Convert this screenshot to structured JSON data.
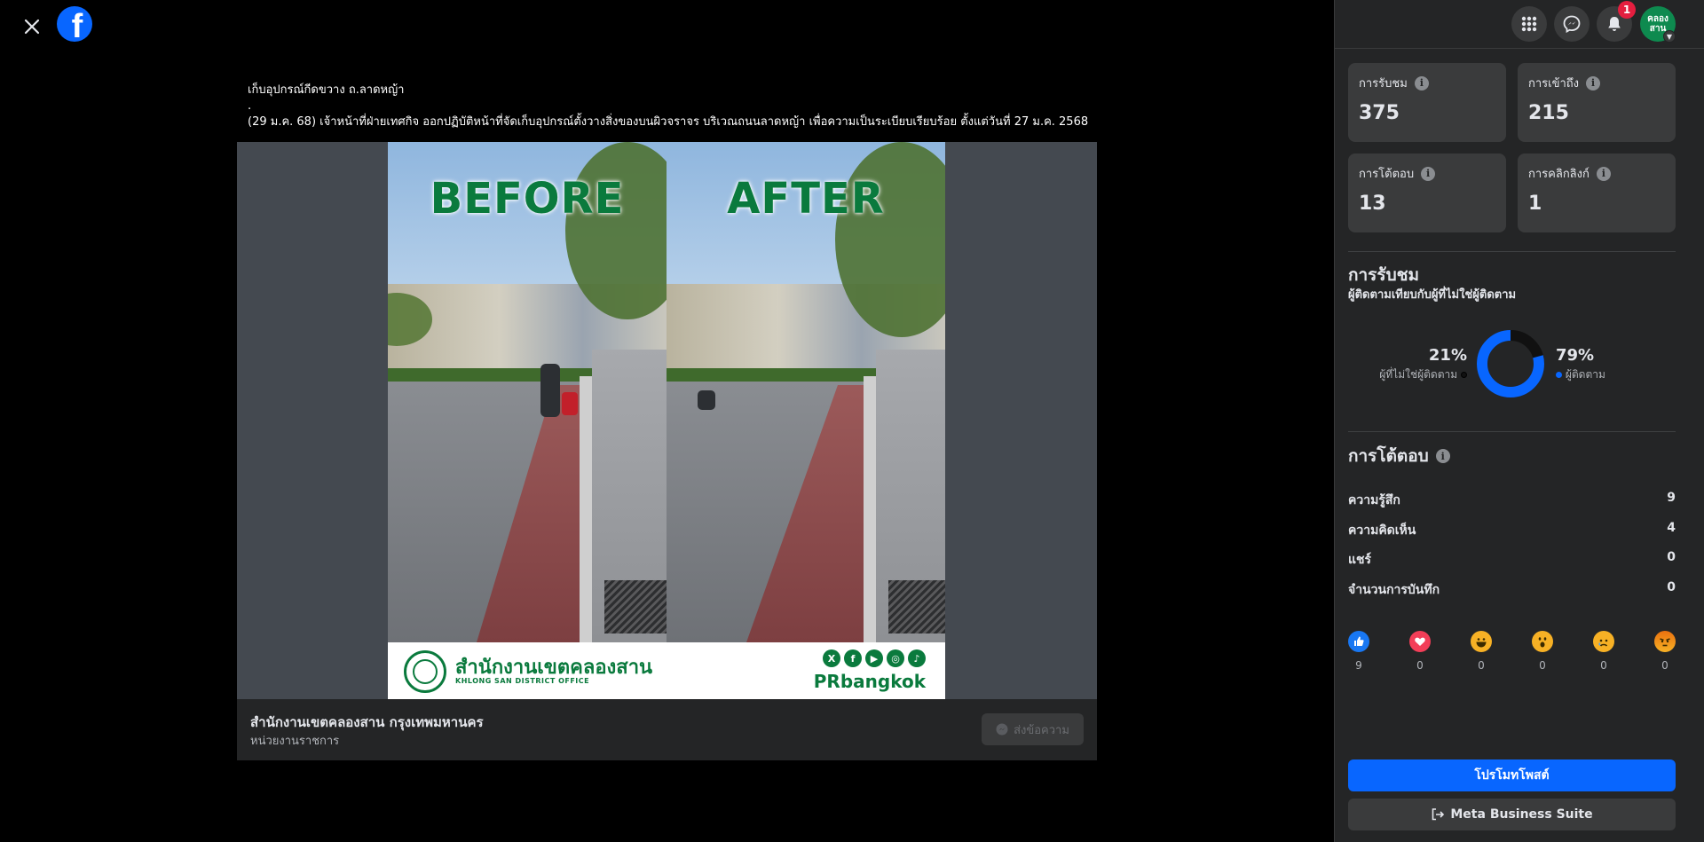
{
  "header": {
    "close_icon": "close-icon",
    "logo_letter": "f"
  },
  "caption": {
    "line1": "เก็บอุปกรณ์กีดขวาง ถ.ลาดหญ้า",
    "line2": ".",
    "line3": "(29 ม.ค. 68) เจ้าหน้าที่ฝ่ายเทศกิจ ออกปฏิบัติหน้าที่จัดเก็บอุปกรณ์ตั้งวางสิ่งของบนผิวจราจร บริเวณถนนลาดหญ้า เพื่อความเป็นระเบียบเรียบร้อย ตั้งแต่วันที่ 27 ม.ค. 2568"
  },
  "photo": {
    "before_label": "BEFORE",
    "after_label": "AFTER",
    "office_th": "สำนักงานเขตคลองสาน",
    "office_en": "KHLONG SAN DISTRICT OFFICE",
    "social": [
      "X",
      "f",
      "▶",
      "◎",
      "♪"
    ],
    "brand": "PRbangkok"
  },
  "page": {
    "name": "สำนักงานเขตคลองสาน กรุงเทพมหานคร",
    "category": "หน่วยงานราชการ",
    "message_label": "ส่งข้อความ"
  },
  "topbar": {
    "notifications_count": "1",
    "avatar_text_1": "คลอง",
    "avatar_text_2": "สาน"
  },
  "stats": [
    {
      "label": "การรับชม",
      "value": "375"
    },
    {
      "label": "การเข้าถึง",
      "value": "215"
    },
    {
      "label": "การโต้ตอบ",
      "value": "13"
    },
    {
      "label": "การคลิกลิงก์",
      "value": "1"
    }
  ],
  "views": {
    "title": "การรับชม",
    "subtitle": "ผู้ติดตามเทียบกับผู้ที่ไม่ใช่ผู้ติดตาม",
    "non_followers_pct": "21%",
    "non_followers_label": "ผู้ที่ไม่ใช่ผู้ติดตาม",
    "followers_pct": "79%",
    "followers_label": "ผู้ติดตาม",
    "followers_fraction": 0.79,
    "colors": {
      "followers": "#0866ff",
      "non_followers": "#111111"
    }
  },
  "interactions": {
    "title": "การโต้ตอบ",
    "metrics": [
      {
        "label": "ความรู้สึก",
        "value": "9"
      },
      {
        "label": "ความคิดเห็น",
        "value": "4"
      },
      {
        "label": "แชร์",
        "value": "0"
      },
      {
        "label": "จำนวนการบันทึก",
        "value": "0"
      }
    ],
    "reactions": [
      {
        "name": "like",
        "count": "9"
      },
      {
        "name": "love",
        "count": "0"
      },
      {
        "name": "haha",
        "count": "0"
      },
      {
        "name": "wow",
        "count": "0"
      },
      {
        "name": "sad",
        "count": "0"
      },
      {
        "name": "angry",
        "count": "0"
      }
    ]
  },
  "buttons": {
    "promote": "โปรโมทโพสต์",
    "business_suite": "Meta Business Suite"
  }
}
